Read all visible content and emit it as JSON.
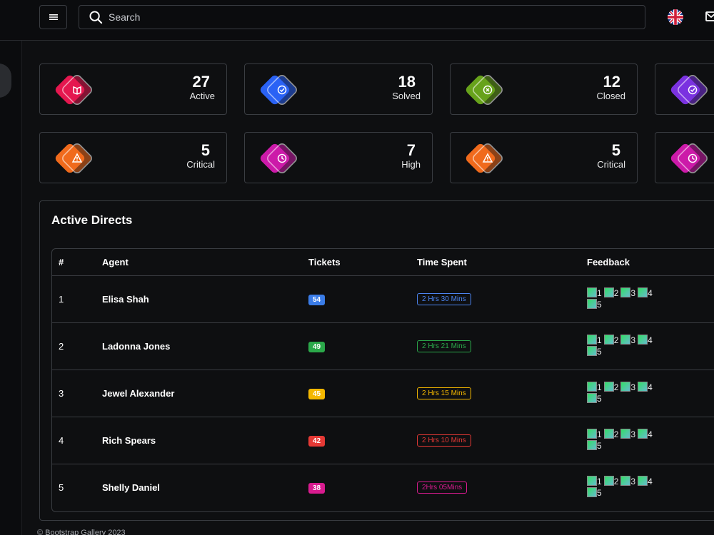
{
  "header": {
    "search_placeholder": "Search",
    "menu_icon": "hamburger-icon",
    "language_icon": "uk-flag-icon",
    "mail_icon": "mail-icon"
  },
  "stats": [
    {
      "value": "27",
      "label": "Active",
      "icon": "book-icon",
      "color": "#e5174f"
    },
    {
      "value": "18",
      "label": "Solved",
      "icon": "check-circle-icon",
      "color": "#2a62f5"
    },
    {
      "value": "12",
      "label": "Closed",
      "icon": "x-circle-icon",
      "color": "#67a21b"
    },
    {
      "value": "",
      "label": "",
      "icon": "check-circle-icon",
      "color": "#7a32e0"
    },
    {
      "value": "5",
      "label": "Critical",
      "icon": "warning-icon",
      "color": "#f06a1c"
    },
    {
      "value": "7",
      "label": "High",
      "icon": "clock-icon",
      "color": "#cc1aa9"
    },
    {
      "value": "5",
      "label": "Critical",
      "icon": "warning-icon",
      "color": "#f06a1c"
    },
    {
      "value": "",
      "label": "",
      "icon": "clock-icon",
      "color": "#cc1aa9"
    }
  ],
  "panel": {
    "title": "Active Directs",
    "columns": [
      "#",
      "Agent",
      "Tickets",
      "Time Spent",
      "Feedback"
    ],
    "rows": [
      {
        "num": "1",
        "agent": "Elisa Shah",
        "tickets": "54",
        "ticket_color": "#3a7ce8",
        "time": "2 Hrs 30 Mins",
        "time_color": "#4c84f0"
      },
      {
        "num": "2",
        "agent": "Ladonna Jones",
        "tickets": "49",
        "ticket_color": "#2ba84a",
        "time": "2 Hrs 21 Mins",
        "time_color": "#2ba84a"
      },
      {
        "num": "3",
        "agent": "Jewel Alexander",
        "tickets": "45",
        "ticket_color": "#f5b800",
        "time": "2 Hrs 15 Mins",
        "time_color": "#f5b800"
      },
      {
        "num": "4",
        "agent": "Rich Spears",
        "tickets": "42",
        "ticket_color": "#e53935",
        "time": "2 Hrs 10 Mins",
        "time_color": "#e53935"
      },
      {
        "num": "5",
        "agent": "Shelly Daniel",
        "tickets": "38",
        "ticket_color": "#d81b8f",
        "time": "2Hrs 05Mins",
        "time_color": "#d81b8f"
      }
    ],
    "feedback_labels": [
      "1",
      "2",
      "3",
      "4",
      "5"
    ]
  },
  "footer": "© Bootstrap Gallery 2023"
}
